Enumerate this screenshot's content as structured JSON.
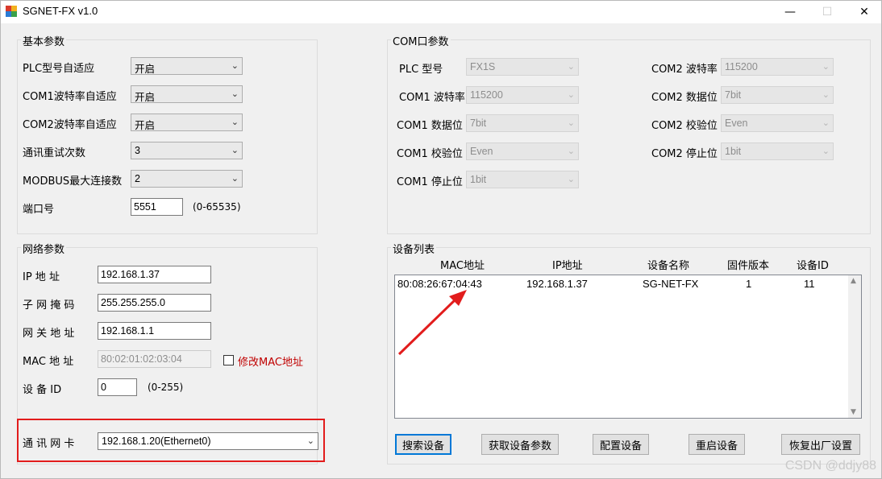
{
  "window": {
    "title": "SGNET-FX v1.0",
    "minimize": "—",
    "maximize": "☐",
    "close": "✕"
  },
  "basic": {
    "title": "基本参数",
    "plc_auto_label": "PLC型号自适应",
    "plc_auto_value": "开启",
    "com1_baud_auto_label": "COM1波特率自适应",
    "com1_baud_auto_value": "开启",
    "com2_baud_auto_label": "COM2波特率自适应",
    "com2_baud_auto_value": "开启",
    "retry_label": "通讯重试次数",
    "retry_value": "3",
    "modbus_label": "MODBUS最大连接数",
    "modbus_value": "2",
    "port_label": "端口号",
    "port_value": "5551",
    "port_range": "(0-65535)"
  },
  "com": {
    "title": "COM口参数",
    "plc_model_label": "PLC 型号",
    "plc_model_value": "FX1S",
    "com1_baud_label": "COM1 波特率",
    "com1_baud_value": "115200",
    "com1_data_label": "COM1 数据位",
    "com1_data_value": "7bit",
    "com1_parity_label": "COM1 校验位",
    "com1_parity_value": "Even",
    "com1_stop_label": "COM1 停止位",
    "com1_stop_value": "1bit",
    "com2_baud_label": "COM2 波特率",
    "com2_baud_value": "115200",
    "com2_data_label": "COM2 数据位",
    "com2_data_value": "7bit",
    "com2_parity_label": "COM2 校验位",
    "com2_parity_value": "Even",
    "com2_stop_label": "COM2 停止位",
    "com2_stop_value": "1bit"
  },
  "network": {
    "title": "网络参数",
    "ip_label": "IP 地 址",
    "ip_value": "192.168.1.37",
    "mask_label": "子 网 掩 码",
    "mask_value": "255.255.255.0",
    "gateway_label": "网 关 地 址",
    "gateway_value": "192.168.1.1",
    "mac_label": "MAC  地 址",
    "mac_value": "80:02:01:02:03:04",
    "mac_modify_label": "修改MAC地址",
    "device_id_label": "设 备 ID",
    "device_id_value": "0",
    "device_id_range": "(0-255)",
    "nic_label": "通 讯 网 卡",
    "nic_value": "192.168.1.20(Ethernet0)"
  },
  "devices": {
    "title": "设备列表",
    "columns": [
      "MAC地址",
      "IP地址",
      "设备名称",
      "固件版本",
      "设备ID"
    ],
    "rows": [
      [
        "80:08:26:67:04:43",
        "192.168.1.37",
        "SG-NET-FX",
        "1",
        "11"
      ]
    ]
  },
  "buttons": {
    "search": "搜索设备",
    "get_params": "获取设备参数",
    "config": "配置设备",
    "restart": "重启设备",
    "factory_reset": "恢复出厂设置"
  },
  "watermark": "CSDN @ddjy88",
  "colors": {
    "annotation_red": "#e21c1c",
    "mac_modify_text": "#c00000",
    "default_button_border": "#0078d7"
  }
}
